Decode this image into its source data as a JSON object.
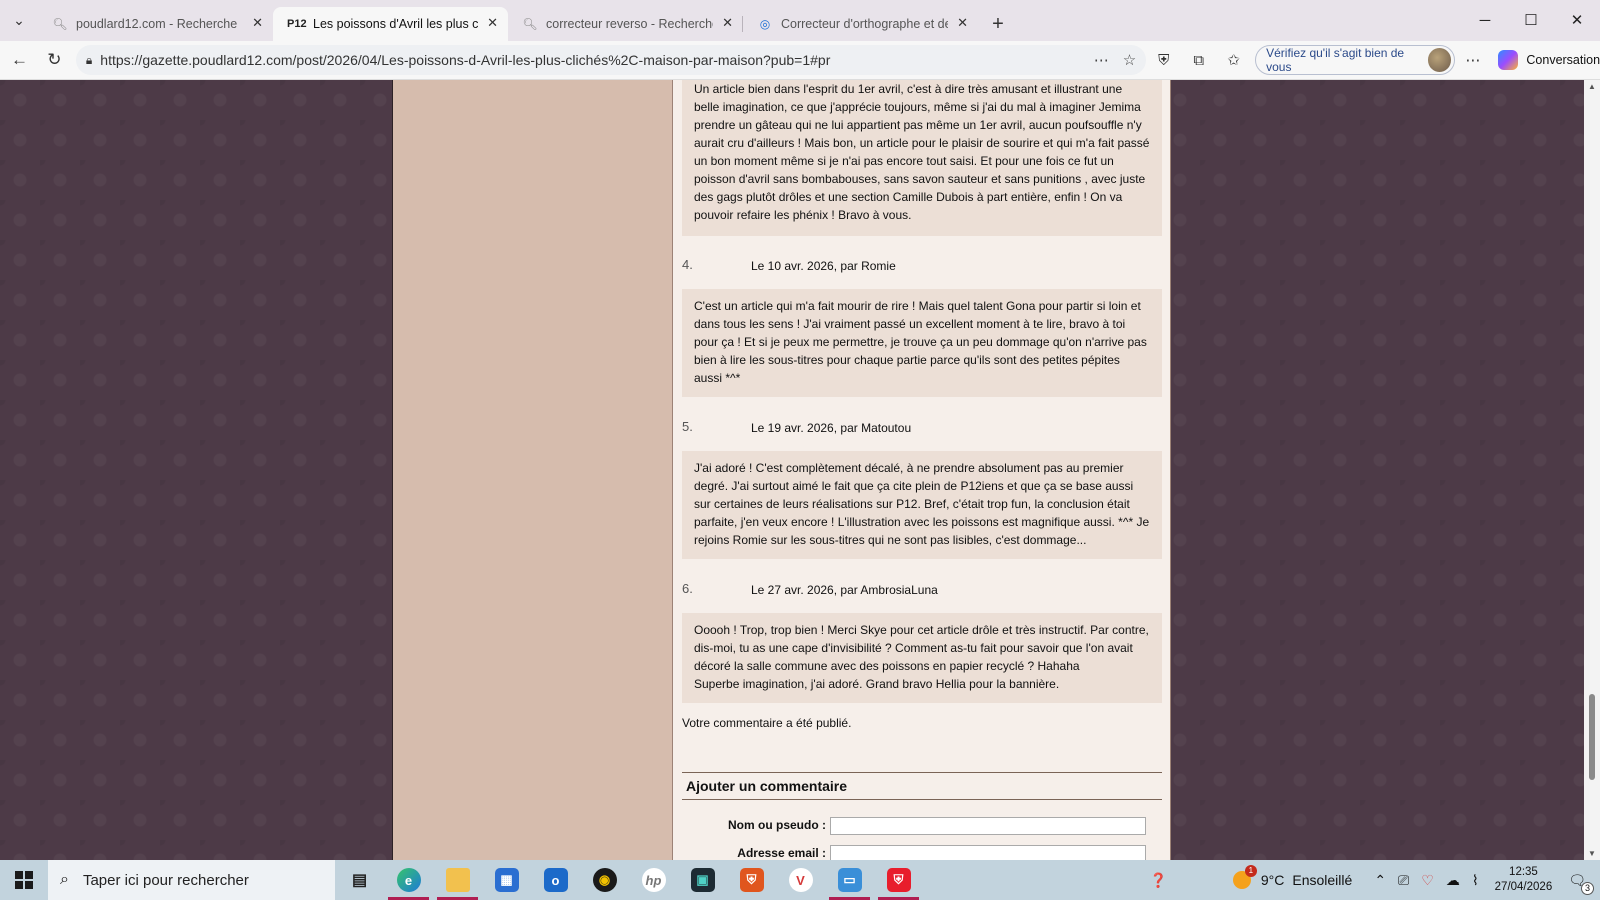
{
  "browser": {
    "tabs": [
      {
        "title": "poudlard12.com - Recherche",
        "icon": "search-icon",
        "active": false
      },
      {
        "title": "Les poissons d'Avril les plus clichés",
        "icon": "p12-favicon",
        "icon_text": "P12",
        "active": true
      },
      {
        "title": "correcteur reverso - Recherche",
        "icon": "search-icon",
        "active": false
      },
      {
        "title": "Correcteur d'orthographe et de grammaire",
        "icon": "reverso-icon",
        "active": false
      }
    ],
    "url": "https://gazette.poudlard12.com/post/2026/04/Les-poissons-d-Avril-les-plus-clichés%2C-maison-par-maison?pub=1#pr",
    "verify_button": "Vérifiez qu'il s'agit bien de vous",
    "copilot_label": "Conversation"
  },
  "page": {
    "comments": [
      {
        "number": "",
        "header": "",
        "text": "Un article bien dans l'esprit du 1er avril, c'est à dire très amusant et illustrant une belle imagination, ce que j'apprécie toujours, même si j'ai du mal à imaginer Jemima prendre un gâteau qui ne lui appartient pas même un 1er avril, aucun poufsouffle n'y aurait cru d'ailleurs ! Mais bon, un article pour le plaisir de sourire et qui m'a fait passé un bon moment même si je n'ai pas encore tout saisi. Et pour une fois ce fut un poisson d'avril sans bombabouses, sans savon sauteur et sans punitions , avec juste des gags plutôt drôles et une section Camille Dubois à part entière, enfin ! On va pouvoir refaire les phénix ! Bravo à vous."
      },
      {
        "number": "4.",
        "header": "Le 10 avr. 2026, par Romie",
        "text": "C'est un article qui m'a fait mourir de rire ! Mais quel talent Gona pour partir si loin et dans tous les sens ! J'ai vraiment passé un excellent moment à te lire, bravo à toi pour ça ! Et si je peux me permettre, je trouve ça un peu dommage qu'on n'arrive pas bien à lire les sous-titres pour chaque partie parce qu'ils sont des petites pépites aussi *^*"
      },
      {
        "number": "5.",
        "header": "Le 19 avr. 2026, par Matoutou",
        "text": "J'ai adoré ! C'est complètement décalé, à ne prendre absolument pas au premier degré. J'ai surtout aimé le fait que ça cite plein de P12iens et que ça se base aussi sur certaines de leurs réalisations sur P12. Bref, c'était trop fun, la conclusion était parfaite, j'en veux encore ! L'illustration avec les poissons est magnifique aussi. *^* Je rejoins Romie sur les sous-titres qui ne sont pas lisibles, c'est dommage..."
      },
      {
        "number": "6.",
        "header": "Le 27 avr. 2026, par AmbrosiaLuna",
        "text": "Ooooh ! Trop, trop bien ! Merci Skye pour cet article drôle et très instructif. Par contre, dis-moi, tu as une cape d'invisibilité ? Comment as-tu fait pour savoir que l'on avait décoré la salle commune avec des poissons en papier recyclé ? Hahaha\nSuperbe imagination, j'ai adoré. Grand bravo Hellia pour la bannière."
      }
    ],
    "published_message": "Votre commentaire a été publié.",
    "add_comment": {
      "title": "Ajouter un commentaire",
      "name_label": "Nom ou pseudo :",
      "email_label": "Adresse email :"
    }
  },
  "taskbar": {
    "search_placeholder": "Taper ici pour rechercher",
    "weather": {
      "temp": "9°C",
      "condition": "Ensoleillé"
    },
    "time": "12:35",
    "date": "27/04/2026",
    "notification_count": "3"
  }
}
